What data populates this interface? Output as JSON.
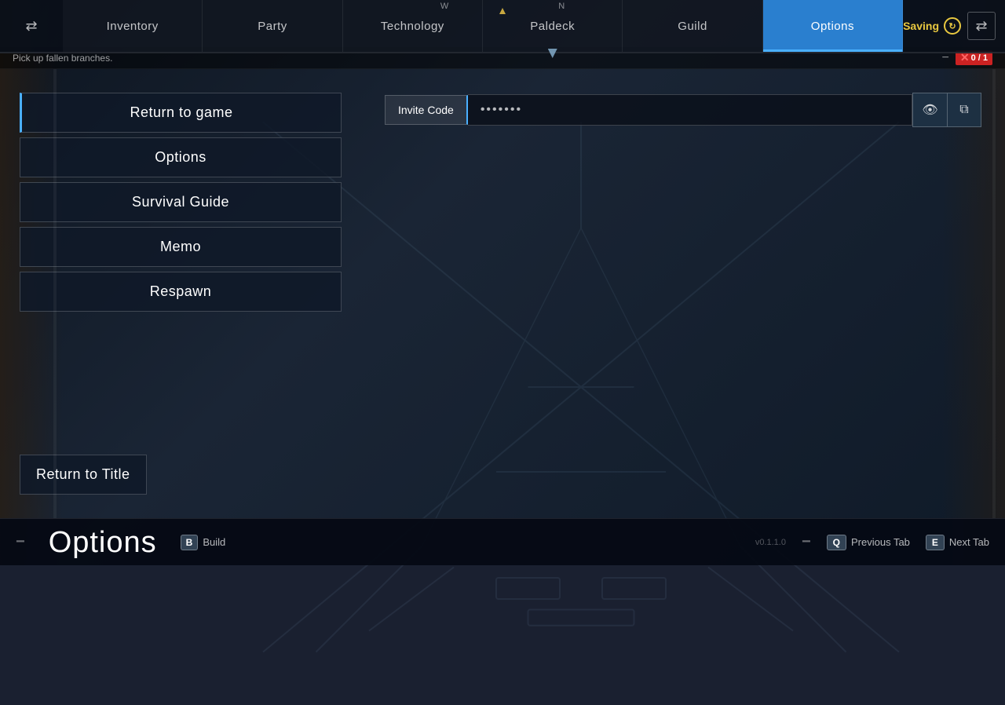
{
  "compass": {
    "west": "W",
    "north": "N"
  },
  "topbar": {
    "swap_label": "⇄",
    "saving_label": "Saving"
  },
  "tabs": [
    {
      "id": "inventory",
      "label": "Inventory",
      "active": false
    },
    {
      "id": "party",
      "label": "Party",
      "active": false
    },
    {
      "id": "technology",
      "label": "Technology",
      "active": false
    },
    {
      "id": "paldeck",
      "label": "Paldeck",
      "active": false
    },
    {
      "id": "guild",
      "label": "Guild",
      "active": false
    },
    {
      "id": "options",
      "label": "Options",
      "active": true
    }
  ],
  "notification": {
    "text": "Pick up fallen branches.",
    "counter": "0 / 1"
  },
  "menu": {
    "return_to_game": "Return to game",
    "options": "Options",
    "survival_guide": "Survival Guide",
    "memo": "Memo",
    "respawn": "Respawn",
    "return_to_title": "Return to Title"
  },
  "invite_code": {
    "label": "Invite Code",
    "value": "*******",
    "eye_icon": "👁",
    "copy_icon": "⧉"
  },
  "bottom": {
    "page_title": "Options",
    "build_key": "B",
    "build_label": "Build",
    "version": "v0.1.1.0",
    "prev_tab_key": "Q",
    "prev_tab_label": "Previous Tab",
    "next_tab_key": "E",
    "next_tab_label": "Next Tab"
  }
}
